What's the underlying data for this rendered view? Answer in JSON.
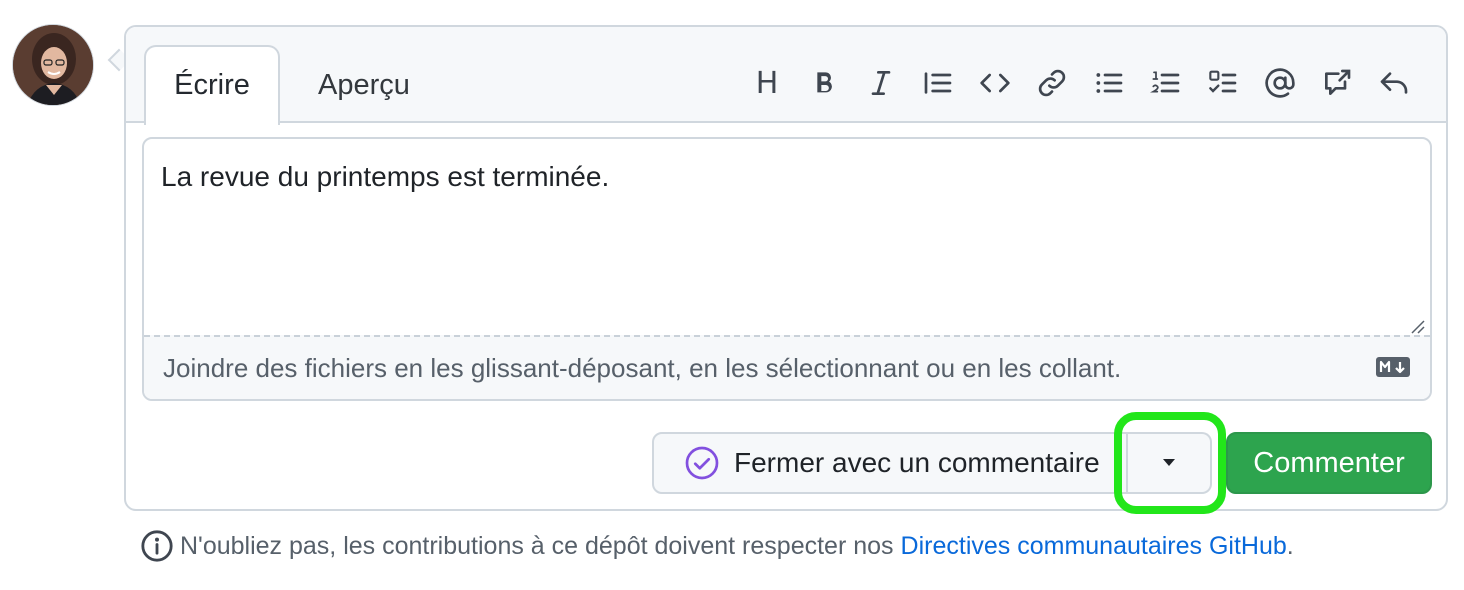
{
  "tabs": {
    "write": "Écrire",
    "preview": "Aperçu"
  },
  "toolbar": {
    "heading": "H",
    "icons": [
      "heading-icon",
      "bold-icon",
      "italic-icon",
      "quote-icon",
      "code-icon",
      "link-icon",
      "bullet-list-icon",
      "numbered-list-icon",
      "task-list-icon",
      "mention-icon",
      "reference-icon",
      "reply-icon"
    ]
  },
  "editor": {
    "text": "La revue du printemps est terminée.",
    "attach_hint": "Joindre des fichiers en les glissant-déposant, en les sélectionnant ou en les collant."
  },
  "actions": {
    "close_label": "Fermer avec un commentaire",
    "comment_label": "Commenter"
  },
  "footnote": {
    "text": "N'oubliez pas, les contributions à ce dépôt doivent respecter nos",
    "link": "Directives communautaires GitHub",
    "suffix": "."
  },
  "colors": {
    "accent_green": "#2da44e",
    "link_blue": "#0969da",
    "close_purple": "#8250df",
    "highlight": "#22e61a"
  }
}
